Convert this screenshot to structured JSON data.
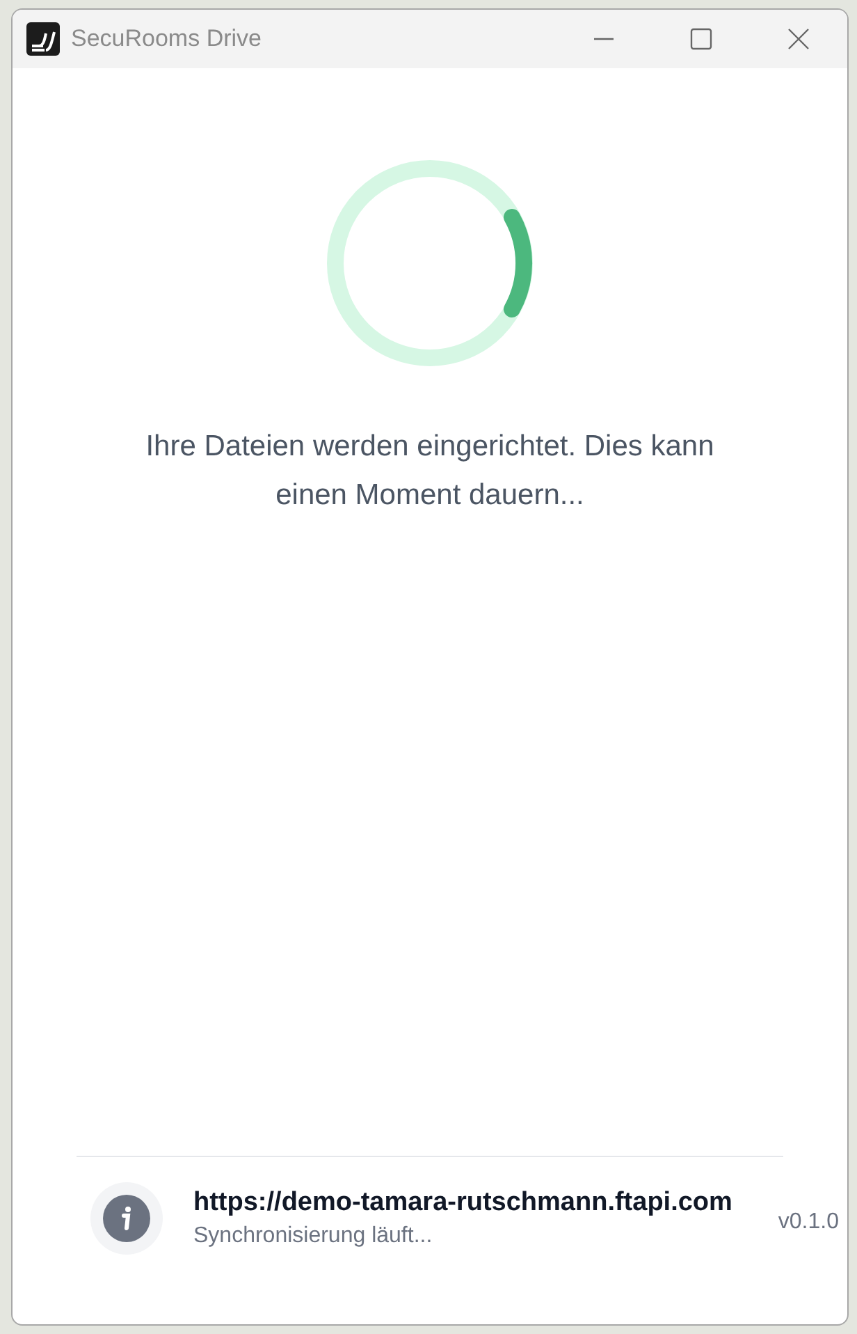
{
  "window": {
    "title": "SecuRooms Drive"
  },
  "message": "Ihre Dateien werden eingerichtet. Dies kann einen Moment dauern...",
  "footer": {
    "url": "https://demo-tamara-rutschmann.ftapi.com",
    "status": "Synchronisierung läuft...",
    "version": "v0.1.0"
  }
}
